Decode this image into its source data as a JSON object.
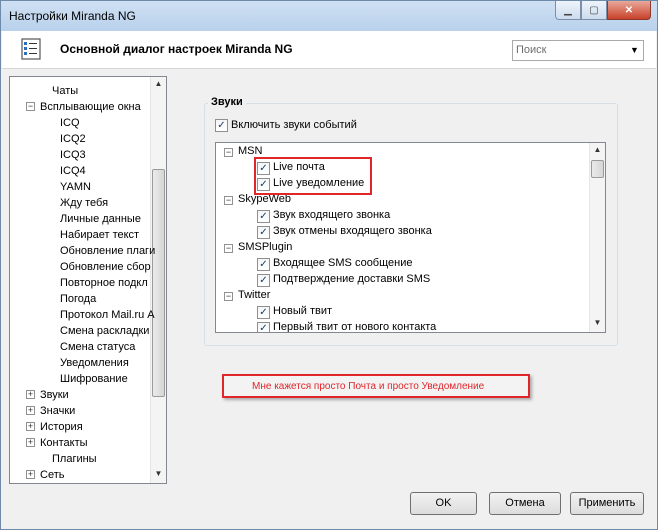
{
  "window": {
    "title": "Настройки Miranda NG"
  },
  "header": {
    "title": "Основной диалог настроек Miranda NG"
  },
  "search": {
    "placeholder": "Поиск"
  },
  "tree": {
    "items": [
      {
        "label": "Чаты"
      },
      {
        "label": "Всплывающие окна",
        "expander": "−"
      },
      {
        "label": "ICQ"
      },
      {
        "label": "ICQ2"
      },
      {
        "label": "ICQ3"
      },
      {
        "label": "ICQ4"
      },
      {
        "label": "YAMN"
      },
      {
        "label": "Жду тебя"
      },
      {
        "label": "Личные данные"
      },
      {
        "label": "Набирает текст"
      },
      {
        "label": "Обновление плаги"
      },
      {
        "label": "Обновление сбор"
      },
      {
        "label": "Повторное подкл"
      },
      {
        "label": "Погода"
      },
      {
        "label": "Протокол Mail.ru А"
      },
      {
        "label": "Смена раскладки"
      },
      {
        "label": "Смена статуса"
      },
      {
        "label": "Уведомления"
      },
      {
        "label": "Шифрование"
      },
      {
        "label": "Звуки",
        "expander": "+"
      },
      {
        "label": "Значки",
        "expander": "+"
      },
      {
        "label": "История",
        "expander": "+"
      },
      {
        "label": "Контакты",
        "expander": "+"
      },
      {
        "label": "Плагины"
      },
      {
        "label": "Сеть",
        "expander": "+"
      }
    ]
  },
  "sounds": {
    "group_title": "Звуки",
    "enable_label": "Включить звуки событий",
    "enable_checked": true,
    "groups": [
      {
        "label": "MSN",
        "items": [
          "Live почта",
          "Live уведомление"
        ]
      },
      {
        "label": "SkypeWeb",
        "items": [
          "Звук входящего звонка",
          "Звук отмены входящего звонка"
        ]
      },
      {
        "label": "SMSPlugin",
        "items": [
          "Входящее SMS сообщение",
          "Подтверждение доставки SMS"
        ]
      },
      {
        "label": "Twitter",
        "items": [
          "Новый твит",
          "Первый твит от нового контакта"
        ]
      }
    ]
  },
  "annotation": {
    "text": "Мне кажется просто Почта и просто Уведомление"
  },
  "buttons": {
    "ok": "OK",
    "cancel": "Отмена",
    "apply": "Применить"
  },
  "colors": {
    "annotation": "#e0262b",
    "titlebar": "#b9d1ec"
  },
  "icons": {
    "minimize": "minimize-icon",
    "maximize": "maximize-icon",
    "close": "close-icon"
  }
}
